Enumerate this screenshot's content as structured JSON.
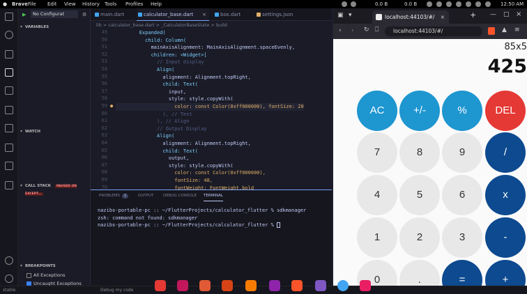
{
  "os_bar": {
    "app": "Brave",
    "menus": [
      "File",
      "Edit",
      "View",
      "History",
      "Tools",
      "Profiles",
      "Help"
    ],
    "net_down": "0.0 B",
    "net_up": "0.0 B",
    "time": "12:50 AM"
  },
  "sidebar": {
    "config": "No Configurat",
    "sections": {
      "variables": "VARIABLES",
      "watch": "WATCH",
      "callstack": "CALL STACK",
      "breakpoints": "BREAKPOINTS"
    },
    "callstack_badge": "PAUSED ON EXCEPT...",
    "breakpoints": [
      {
        "label": "All Exceptions",
        "checked": false
      },
      {
        "label": "Uncaught Exceptions",
        "checked": true
      }
    ]
  },
  "editor": {
    "tabs": [
      "main.dart",
      "calculator_base.dart",
      "box.dart",
      "settings.json"
    ],
    "active_tab": 1,
    "breadcrumb": "lib > calculator_base.dart > _CalculatorBaseState > build"
  },
  "code": [
    {
      "n": "49",
      "t": "        Expanded("
    },
    {
      "n": "50",
      "t": "          child: Column("
    },
    {
      "n": "51",
      "t": "            mainAxisAlignment: MainAxisAlignment.spaceEvenly,"
    },
    {
      "n": "52",
      "t": "            children: <Widget>["
    },
    {
      "n": "53",
      "t": "              // Input display"
    },
    {
      "n": "54",
      "t": "              Align("
    },
    {
      "n": "55",
      "t": "                alignment: Alignment.topRight,"
    },
    {
      "n": "56",
      "t": "                child: Text("
    },
    {
      "n": "57",
      "t": "                  input,"
    },
    {
      "n": "58",
      "t": "                  style: style.copyWith("
    },
    {
      "n": "59",
      "t": "                    color: const Color(0xff000000), fontSize: 20"
    },
    {
      "n": "60",
      "t": "                ), // Text"
    },
    {
      "n": "61",
      "t": "              ), // Align"
    },
    {
      "n": "62",
      "t": "              // Output Display"
    },
    {
      "n": "63",
      "t": "              Align("
    },
    {
      "n": "64",
      "t": "                alignment: Alignment.topRight,"
    },
    {
      "n": "65",
      "t": "                child: Text("
    },
    {
      "n": "66",
      "t": "                  output,"
    },
    {
      "n": "67",
      "t": "                  style: style.copyWith("
    },
    {
      "n": "68",
      "t": "                    color: const Color(0xff000000),"
    },
    {
      "n": "69",
      "t": "                    fontSize: 48,"
    },
    {
      "n": "70",
      "t": "                    fontWeight: FontWeight.bold"
    }
  ],
  "panel": {
    "tabs": [
      "PROBLEMS",
      "OUTPUT",
      "DEBUG CONSOLE",
      "TERMINAL"
    ],
    "problems_count": "1",
    "terminal": [
      "nazibs-portable-pc :: ~/FlutterProjects/calculator_flutter % sdkmanager",
      "zsh: command not found: sdkmanager",
      "nazibs-portable-pc :: ~/FlutterProjects/calculator_flutter % "
    ]
  },
  "status": {
    "left": "stable",
    "mode": "Debug my code"
  },
  "browser": {
    "tab_title": "localhost:44103/#/",
    "url": "localhost:44103/#/"
  },
  "calc": {
    "input": "85x5",
    "output": "425",
    "keys": [
      {
        "label": "AC",
        "style": "blue"
      },
      {
        "label": "+/-",
        "style": "blue"
      },
      {
        "label": "%",
        "style": "blue"
      },
      {
        "label": "DEL",
        "style": "red"
      },
      {
        "label": "7",
        "style": "num"
      },
      {
        "label": "8",
        "style": "num"
      },
      {
        "label": "9",
        "style": "num"
      },
      {
        "label": "/",
        "style": "dark"
      },
      {
        "label": "4",
        "style": "num"
      },
      {
        "label": "5",
        "style": "num"
      },
      {
        "label": "6",
        "style": "num"
      },
      {
        "label": "x",
        "style": "dark"
      },
      {
        "label": "1",
        "style": "num"
      },
      {
        "label": "2",
        "style": "num"
      },
      {
        "label": "3",
        "style": "num"
      },
      {
        "label": "-",
        "style": "dark"
      },
      {
        "label": "0",
        "style": "num"
      },
      {
        "label": ".",
        "style": "num"
      },
      {
        "label": "=",
        "style": "dark"
      },
      {
        "label": "+",
        "style": "dark"
      }
    ]
  },
  "colors": {
    "blue": "#1e96d0",
    "red": "#e53935",
    "dark": "#0d4a8f",
    "num": "#e8e8e8"
  }
}
